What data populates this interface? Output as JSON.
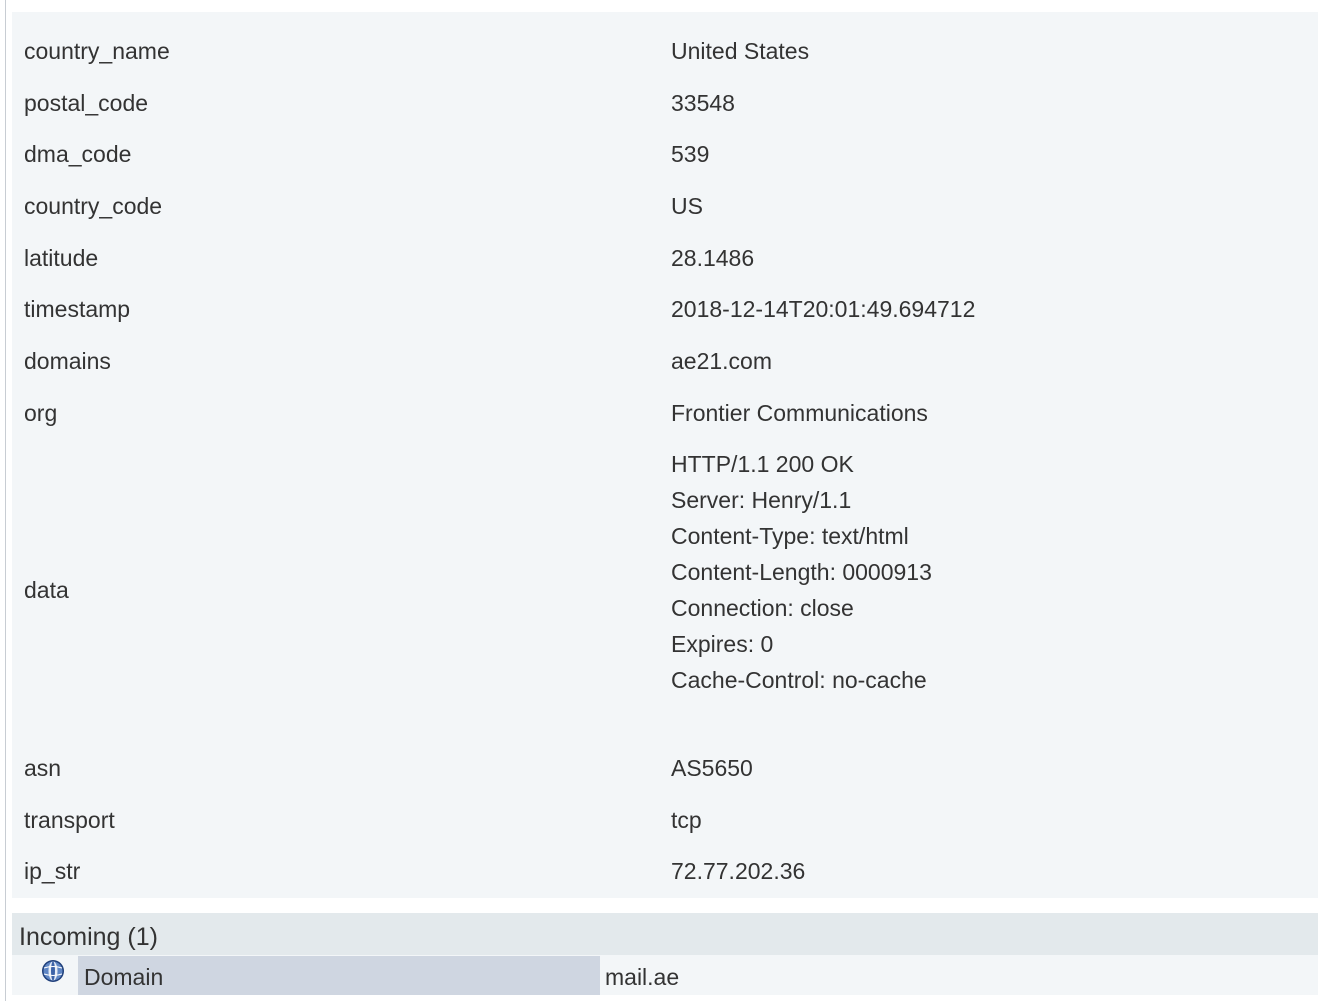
{
  "properties": [
    {
      "key": "country_name",
      "value": "United States"
    },
    {
      "key": "postal_code",
      "value": "33548"
    },
    {
      "key": "dma_code",
      "value": "539"
    },
    {
      "key": "country_code",
      "value": "US"
    },
    {
      "key": "latitude",
      "value": "28.1486"
    },
    {
      "key": "timestamp",
      "value": "2018-12-14T20:01:49.694712"
    },
    {
      "key": "domains",
      "value": "ae21.com"
    },
    {
      "key": "org",
      "value": "Frontier Communications"
    },
    {
      "key": "data",
      "value": "HTTP/1.1 200 OK\nServer: Henry/1.1\nContent-Type: text/html\nContent-Length: 0000913\nConnection: close\nExpires: 0\nCache-Control: no-cache"
    },
    {
      "key": "asn",
      "value": "AS5650"
    },
    {
      "key": "transport",
      "value": "tcp"
    },
    {
      "key": "ip_str",
      "value": "72.77.202.36"
    }
  ],
  "incoming": {
    "title": "Incoming (1)",
    "items": [
      {
        "icon": "globe-icon",
        "label": "Domain",
        "value": "mail.ae"
      }
    ]
  },
  "colors": {
    "panel_bg": "#f3f6f8",
    "header_bg": "#e3e9ec",
    "label_cell_bg": "#cfd6e1",
    "text": "#333333"
  }
}
